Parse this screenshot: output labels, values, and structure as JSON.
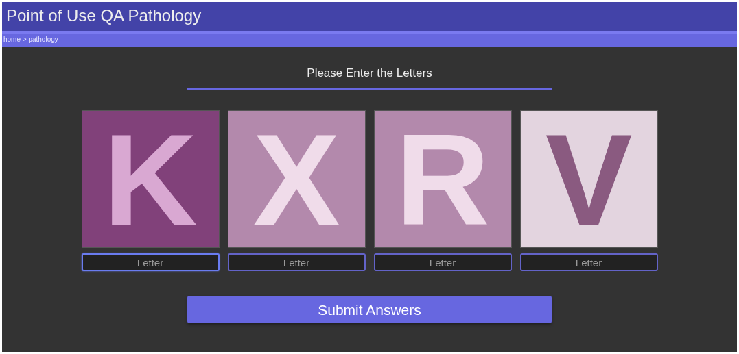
{
  "header": {
    "title": "Point of Use QA Pathology"
  },
  "breadcrumb": "home > pathology",
  "prompt": "Please Enter the Letters",
  "tiles": [
    {
      "letter": "K",
      "color": "#81417a",
      "input": {
        "placeholder": "Letter",
        "focused": true
      }
    },
    {
      "letter": "X",
      "color": "#b389ac",
      "input": {
        "placeholder": "Letter",
        "focused": false
      }
    },
    {
      "letter": "R",
      "color": "#b389ac",
      "input": {
        "placeholder": "Letter",
        "focused": false
      }
    },
    {
      "letter": "V",
      "color": "#e3d4df",
      "input": {
        "placeholder": "Letter",
        "focused": false
      }
    }
  ],
  "submit_button": "Submit Answers"
}
